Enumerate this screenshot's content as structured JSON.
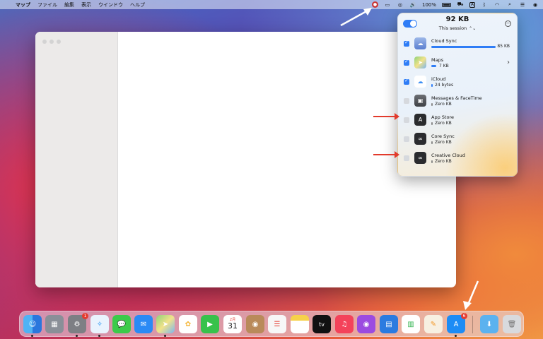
{
  "menubar": {
    "apple": "",
    "app_name": "マップ",
    "menus": [
      "ファイル",
      "編集",
      "表示",
      "ウインドウ",
      "ヘルプ"
    ],
    "battery_percent": "100%",
    "keyboard_input": "A",
    "status_icons": [
      "cloud-sync-monitor-icon",
      "display-icon",
      "airdrop-icon",
      "volume-icon",
      "battery-icon",
      "network-monitor-icon",
      "keyboard-input-icon",
      "bluetooth-icon",
      "wifi-icon",
      "search-icon",
      "control-center-icon",
      "siri-icon"
    ]
  },
  "popover": {
    "total": "92 KB",
    "session_label": "This session",
    "session_chevron": "⌃⌄",
    "close_glyph": "−",
    "apps": [
      {
        "name": "Cloud Sync",
        "size": "85 KB",
        "checked": true,
        "icon": "cloud-sync-icon",
        "usage": 1.0
      },
      {
        "name": "Maps",
        "size": "7 KB",
        "checked": true,
        "icon": "maps-icon",
        "usage": 0.08
      },
      {
        "name": "iCloud",
        "size": "24 bytes",
        "checked": true,
        "icon": "icloud-icon",
        "usage": 0.0
      },
      {
        "name": "Messages & FaceTime",
        "size": "Zero KB",
        "checked": false,
        "icon": "messages-facetime-icon",
        "usage": 0.0
      },
      {
        "name": "App Store",
        "size": "Zero KB",
        "checked": false,
        "icon": "app-store-icon",
        "usage": 0.0
      },
      {
        "name": "Core Sync",
        "size": "Zero KB",
        "checked": false,
        "icon": "core-sync-icon",
        "usage": 0.0
      },
      {
        "name": "Creative Cloud",
        "size": "Zero KB",
        "checked": false,
        "icon": "creative-cloud-icon",
        "usage": 0.0
      }
    ],
    "maps_chevron": "›"
  },
  "dock": {
    "items": [
      {
        "name": "finder-icon",
        "color": "#2d8ef0",
        "running": true
      },
      {
        "name": "launchpad-icon",
        "color": "#8a8f98",
        "running": false
      },
      {
        "name": "system-preferences-icon",
        "color": "#7d7f84",
        "running": true,
        "badge": "1"
      },
      {
        "name": "safari-icon",
        "color": "#1f8ff0",
        "running": true
      },
      {
        "name": "messages-icon",
        "color": "#3ccb4a",
        "running": false
      },
      {
        "name": "mail-icon",
        "color": "#2a8af5",
        "running": false
      },
      {
        "name": "maps-icon",
        "color": "#6fc46a",
        "running": true
      },
      {
        "name": "photos-icon",
        "color": "#f4b73b",
        "running": false
      },
      {
        "name": "facetime-icon",
        "color": "#38c24b",
        "running": false
      },
      {
        "name": "calendar-icon",
        "color": "#ffffff",
        "running": false,
        "label": "31",
        "sublabel": "2月"
      },
      {
        "name": "contacts-icon",
        "color": "#b98a5a",
        "running": false
      },
      {
        "name": "reminders-icon",
        "color": "#f7f7f7",
        "running": false
      },
      {
        "name": "notes-icon",
        "color": "#f6d14a",
        "running": false
      },
      {
        "name": "apple-tv-icon",
        "color": "#111111",
        "running": false,
        "label": "tv"
      },
      {
        "name": "music-icon",
        "color": "#f4425a",
        "running": false
      },
      {
        "name": "podcasts-icon",
        "color": "#9b4be0",
        "running": false
      },
      {
        "name": "keynote-icon",
        "color": "#2b7be0",
        "running": false
      },
      {
        "name": "numbers-icon",
        "color": "#2fb24c",
        "running": false
      },
      {
        "name": "pages-icon",
        "color": "#f39a2c",
        "running": false
      },
      {
        "name": "app-store-dock-icon",
        "color": "#1d8cf5",
        "running": true,
        "badge": "6"
      },
      {
        "name": "downloads-folder-icon",
        "color": "#5bb2ef",
        "running": false
      },
      {
        "name": "trash-icon",
        "color": "#d8dadd",
        "running": false
      }
    ]
  }
}
